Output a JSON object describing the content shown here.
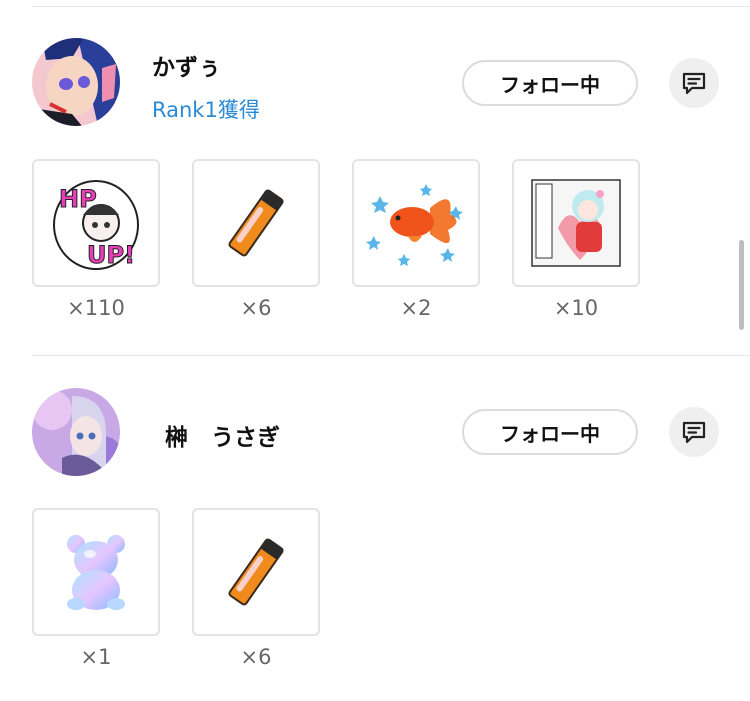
{
  "users": [
    {
      "name": "かずぅ",
      "rank": "Rank1獲得",
      "follow_label": "フォロー中",
      "gifts": [
        {
          "icon": "hp-up-sticker-icon",
          "count": "×110"
        },
        {
          "icon": "glowstick-icon",
          "count": "×6"
        },
        {
          "icon": "goldfish-icon",
          "count": "×2"
        },
        {
          "icon": "love-card-sticker-icon",
          "count": "×10"
        }
      ]
    },
    {
      "name": "榊　うさぎ",
      "follow_label": "フォロー中",
      "gifts": [
        {
          "icon": "crystal-bear-icon",
          "count": "×1"
        },
        {
          "icon": "glowstick-icon",
          "count": "×6"
        }
      ]
    }
  ],
  "colors": {
    "rank": "#2a8ad6",
    "accent_pink": "#e83fb8"
  }
}
